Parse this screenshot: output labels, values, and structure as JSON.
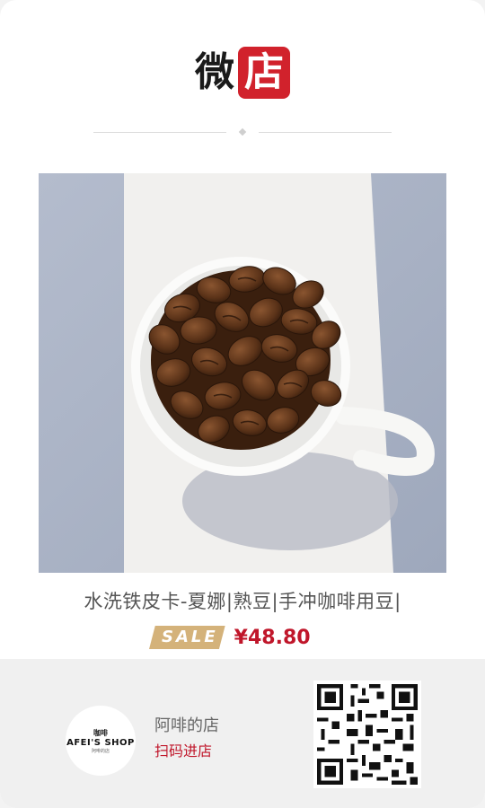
{
  "header": {
    "logo_left": "微",
    "logo_right": "店"
  },
  "product": {
    "title": "水洗铁皮卡-夏娜|熟豆|手冲咖啡用豆|",
    "sale_label": "SALE",
    "price": "¥48.80"
  },
  "shop": {
    "avatar_mini": "咖啡",
    "avatar_brand": "AFEI'S SHOP",
    "avatar_sub": "阿啡的店",
    "name": "阿啡的店",
    "enter": "扫码进店"
  },
  "colors": {
    "brand_red": "#d1222c",
    "price_red": "#c0162a",
    "sale_gold": "#d4b27a"
  }
}
